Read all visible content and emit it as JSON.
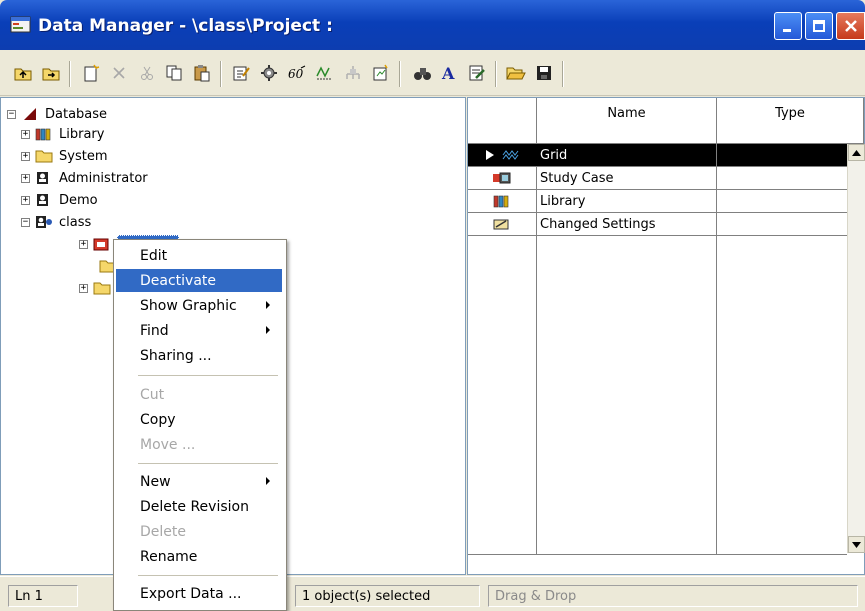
{
  "window": {
    "title": "Data Manager - \\class\\Project :",
    "minimize_label": "_",
    "maximize_label": "□",
    "close_label": "X"
  },
  "toolbar": {
    "icons": [
      "up-level-icon",
      "open-folder-icon",
      "new-object-icon",
      "delete-icon",
      "cut-icon",
      "copy-icon",
      "paste-icon",
      "edit-icon",
      "settings-icon",
      "variable-icon",
      "filter-icon",
      "network-icon",
      "new-project-icon",
      "find-icon",
      "font-icon",
      "report-icon",
      "open-icon",
      "save-icon"
    ]
  },
  "tree": {
    "items": [
      {
        "label": "Database",
        "expander": "−",
        "icon": "database-icon"
      },
      {
        "label": "Library",
        "expander": "+",
        "icon": "library-icon"
      },
      {
        "label": "System",
        "expander": "+",
        "icon": "folder-icon"
      },
      {
        "label": "Administrator",
        "expander": "+",
        "icon": "user-icon"
      },
      {
        "label": "Demo",
        "expander": "+",
        "icon": "user-icon"
      },
      {
        "label": "class",
        "expander": "−",
        "icon": "user-icon"
      }
    ]
  },
  "list": {
    "columns": [
      "Name",
      "Type"
    ],
    "rows": [
      {
        "name": "Grid",
        "type": "",
        "icon": "grid-icon",
        "selected": true
      },
      {
        "name": "Study Case",
        "type": "",
        "icon": "study-case-icon",
        "selected": false
      },
      {
        "name": "Library",
        "type": "",
        "icon": "library-icon",
        "selected": false
      },
      {
        "name": "Changed Settings",
        "type": "",
        "icon": "changed-settings-icon",
        "selected": false
      }
    ]
  },
  "context_menu": {
    "items": [
      {
        "label": "Edit",
        "disabled": false,
        "submenu": false
      },
      {
        "label": "Deactivate",
        "disabled": false,
        "submenu": false,
        "highlighted": true
      },
      {
        "label": "Show Graphic",
        "disabled": false,
        "submenu": true
      },
      {
        "label": "Find",
        "disabled": false,
        "submenu": true
      },
      {
        "label": "Sharing ...",
        "disabled": false,
        "submenu": false
      },
      {
        "label": "Cut",
        "disabled": true,
        "submenu": false
      },
      {
        "label": "Copy",
        "disabled": false,
        "submenu": false
      },
      {
        "label": "Move ...",
        "disabled": true,
        "submenu": false
      },
      {
        "label": "New",
        "disabled": false,
        "submenu": true
      },
      {
        "label": "Delete Revision",
        "disabled": false,
        "submenu": false
      },
      {
        "label": "Delete",
        "disabled": true,
        "submenu": false
      },
      {
        "label": "Rename",
        "disabled": false,
        "submenu": false
      },
      {
        "label": "Export Data ...",
        "disabled": false,
        "submenu": false
      }
    ]
  },
  "statusbar": {
    "line": "Ln 1",
    "selection": "1 object(s) selected",
    "mode": "Drag & Drop"
  },
  "colors": {
    "selection": "#316ac5",
    "title_bar": "#0a3fb8"
  }
}
